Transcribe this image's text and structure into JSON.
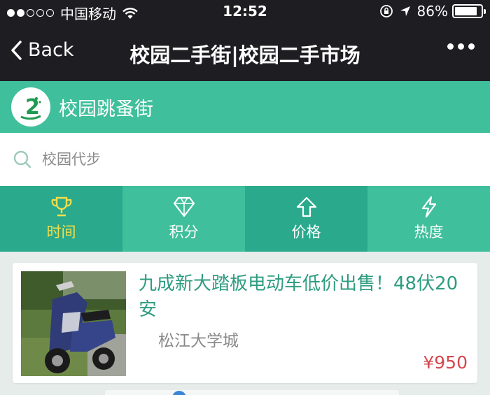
{
  "status_bar": {
    "carrier": "中国移动",
    "time": "12:52",
    "battery": "86%",
    "battery_level": 0.86
  },
  "nav": {
    "back_label": "Back",
    "title": "校园二手街|校园二手市场"
  },
  "app": {
    "name": "校园跳蚤街",
    "logo_char": "2"
  },
  "search": {
    "placeholder": "校园代步"
  },
  "tabs": [
    {
      "label": "时间",
      "icon": "trophy-icon",
      "active": true
    },
    {
      "label": "积分",
      "icon": "diamond-icon",
      "active": false
    },
    {
      "label": "价格",
      "icon": "arrow-up-icon",
      "active": false
    },
    {
      "label": "热度",
      "icon": "lightning-icon",
      "active": false
    }
  ],
  "listing": {
    "title": "九成新大踏板电动车低价出售！48伏20安",
    "location": "松江大学城",
    "price": "¥950"
  },
  "colors": {
    "dark_bar": "#1e1e22",
    "brand_green": "#3fbf9b",
    "tab_dark": "#2aa98c",
    "active_tab_text": "#f3de4a",
    "title_green": "#2e9c80",
    "price_red": "#d6464f"
  }
}
